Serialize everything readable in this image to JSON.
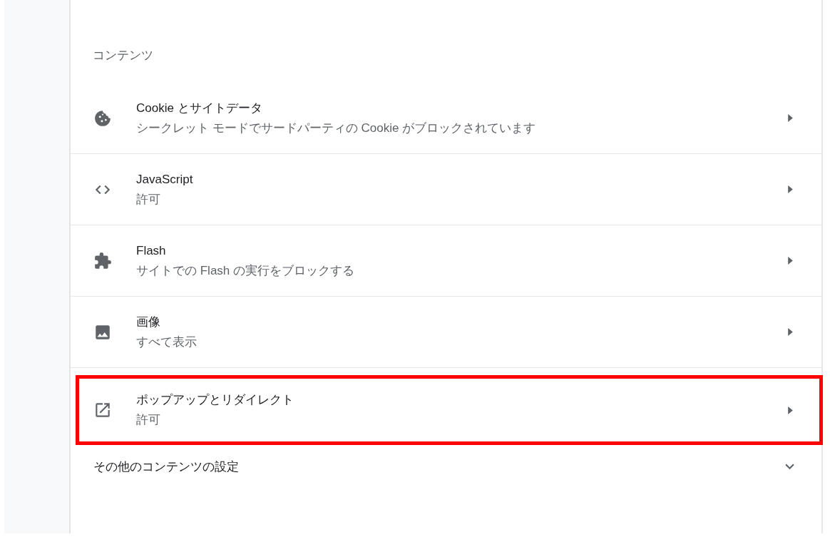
{
  "section_title": "コンテンツ",
  "items": [
    {
      "title": "Cookie とサイトデータ",
      "subtitle": "シークレット モードでサードパーティの Cookie がブロックされています",
      "highlighted": false
    },
    {
      "title": "JavaScript",
      "subtitle": "許可",
      "highlighted": false
    },
    {
      "title": "Flash",
      "subtitle": "サイトでの Flash の実行をブロックする",
      "highlighted": false
    },
    {
      "title": "画像",
      "subtitle": "すべて表示",
      "highlighted": false
    },
    {
      "title": "ポップアップとリダイレクト",
      "subtitle": "許可",
      "highlighted": true
    }
  ],
  "more_settings": {
    "label": "その他のコンテンツの設定",
    "expanded": false
  }
}
